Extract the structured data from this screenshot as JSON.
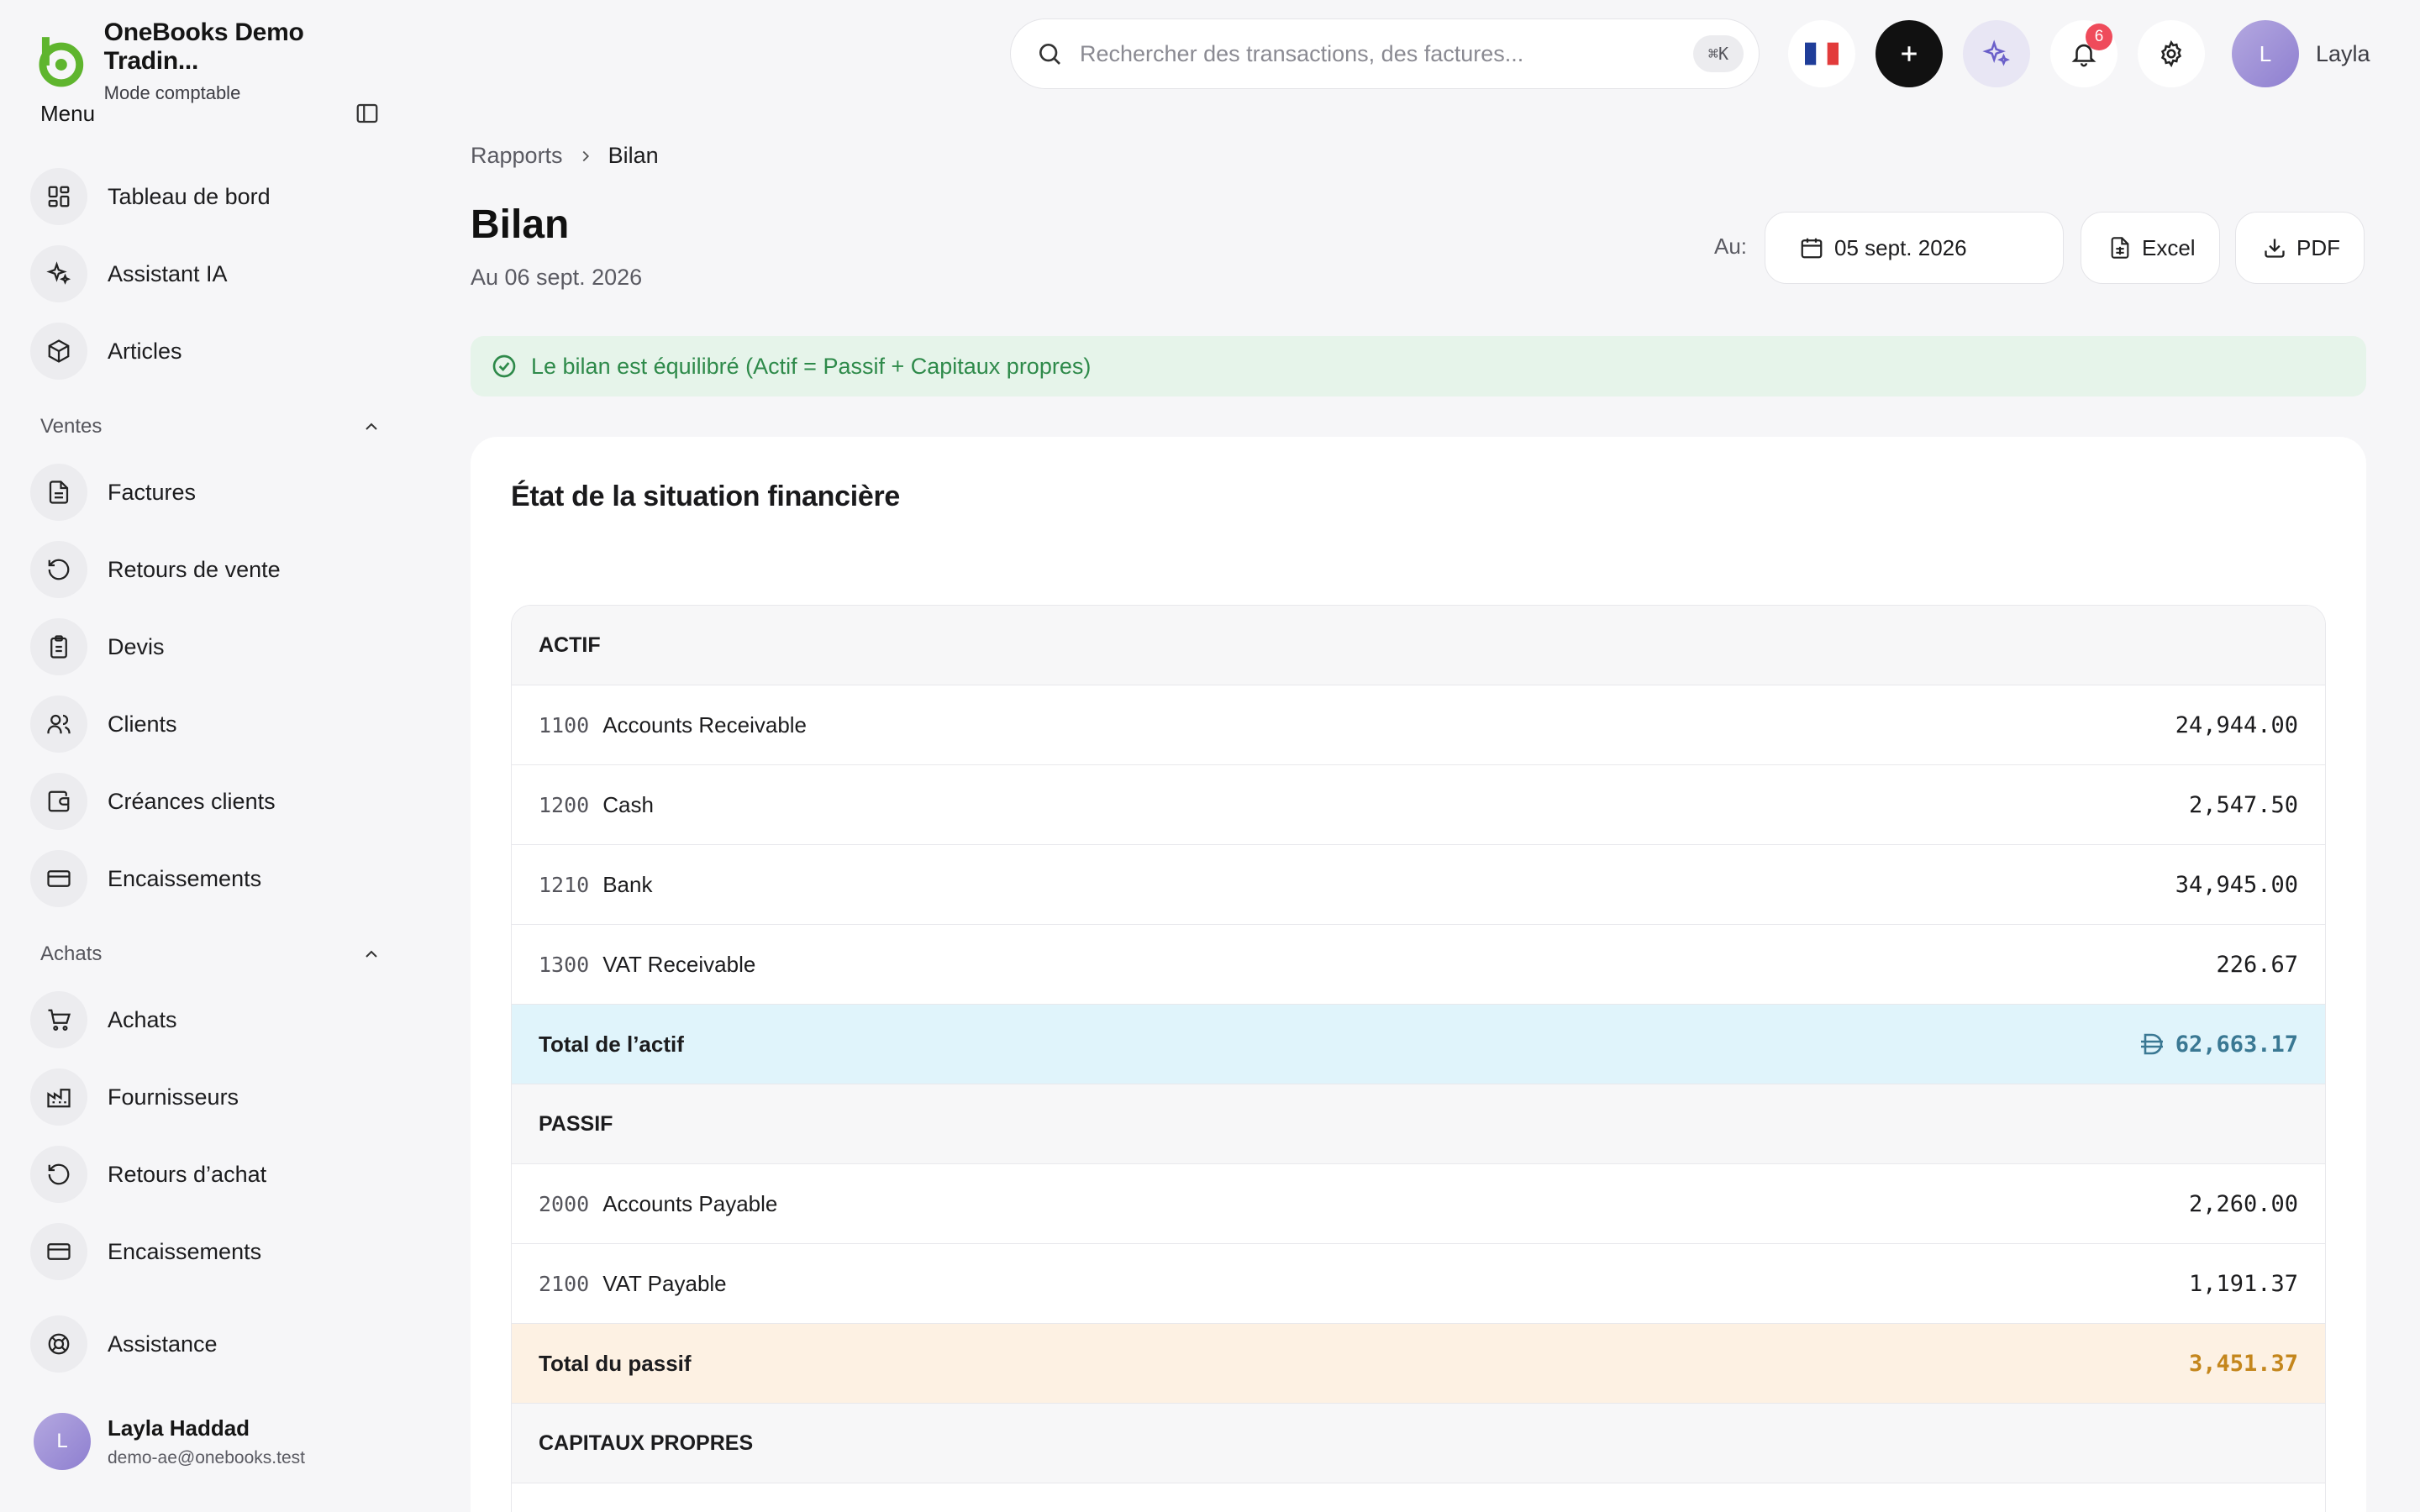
{
  "app": {
    "company_name": "OneBooks Demo Tradin...",
    "mode": "Mode comptable"
  },
  "sidebar": {
    "menu_title": "Menu",
    "top_items": [
      {
        "label": "Tableau de bord",
        "icon": "dashboard-icon"
      },
      {
        "label": "Assistant IA",
        "icon": "sparkles-icon"
      },
      {
        "label": "Articles",
        "icon": "box-icon"
      }
    ],
    "sales_section": {
      "label": "Ventes",
      "items": [
        {
          "label": "Factures",
          "icon": "document-icon"
        },
        {
          "label": "Retours de vente",
          "icon": "rotate-ccw-icon"
        },
        {
          "label": "Devis",
          "icon": "clipboard-icon"
        },
        {
          "label": "Clients",
          "icon": "users-icon"
        },
        {
          "label": "Créances clients",
          "icon": "wallet-icon"
        },
        {
          "label": "Encaissements",
          "icon": "credit-card-icon"
        }
      ]
    },
    "purchases_section": {
      "label": "Achats",
      "items": [
        {
          "label": "Achats",
          "icon": "shopping-cart-icon"
        },
        {
          "label": "Fournisseurs",
          "icon": "factory-icon"
        },
        {
          "label": "Retours d’achat",
          "icon": "rotate-ccw-icon"
        },
        {
          "label": "Encaissements",
          "icon": "credit-card-icon"
        }
      ]
    },
    "support": {
      "label": "Assistance",
      "icon": "lifebuoy-icon"
    },
    "user": {
      "initial": "L",
      "name": "Layla Haddad",
      "email": "demo-ae@onebooks.test"
    }
  },
  "topbar": {
    "search_placeholder": "Rechercher des transactions, des factures...",
    "search_shortcut": "⌘K",
    "notification_count": "6",
    "user_initial": "L",
    "user_name": "Layla"
  },
  "page": {
    "breadcrumb_parent": "Rapports",
    "breadcrumb_current": "Bilan",
    "title": "Bilan",
    "subtitle": "Au 06 sept. 2026",
    "date_label": "Au:",
    "date_value": "05 sept. 2026",
    "excel_label": "Excel",
    "pdf_label": "PDF",
    "balance_message": "Le bilan est équilibré (Actif = Passif + Capitaux propres)"
  },
  "statement": {
    "title": "État de la situation financière",
    "assets_header": "ACTIF",
    "assets": [
      {
        "code": "1100",
        "name": "Accounts Receivable",
        "amount": "24,944.00"
      },
      {
        "code": "1200",
        "name": "Cash",
        "amount": "2,547.50"
      },
      {
        "code": "1210",
        "name": "Bank",
        "amount": "34,945.00"
      },
      {
        "code": "1300",
        "name": "VAT Receivable",
        "amount": "226.67"
      }
    ],
    "total_assets_label": "Total de l’actif",
    "total_assets_amount": "62,663.17",
    "liabilities_header": "PASSIF",
    "liabilities": [
      {
        "code": "2000",
        "name": "Accounts Payable",
        "amount": "2,260.00"
      },
      {
        "code": "2100",
        "name": "VAT Payable",
        "amount": "1,191.37"
      }
    ],
    "total_liabilities_label": "Total du passif",
    "total_liabilities_amount": "3,451.37",
    "equity_header": "CAPITAUX PROPRES"
  },
  "colors": {
    "accent_green": "#5fb52e",
    "balanced_text": "#2e8a4a",
    "total_assets_bg": "#e0f4fb",
    "total_liabilities_bg": "#fdf1e3",
    "notification_badge": "#ef4b5b"
  }
}
